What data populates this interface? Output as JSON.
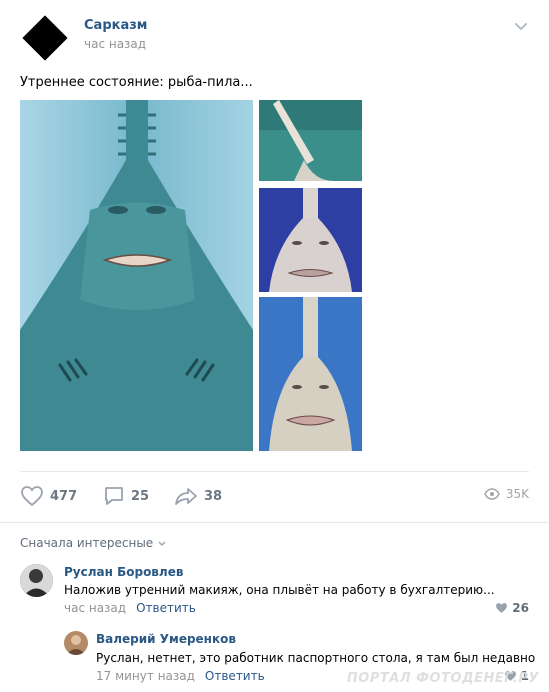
{
  "post": {
    "author": "Сарказм",
    "time": "час назад",
    "text": "Утреннее состояние: рыба-пила..."
  },
  "actions": {
    "likes": "477",
    "comments": "25",
    "shares": "38",
    "views": "35K"
  },
  "sort_label": "Сначала интересные",
  "comments": [
    {
      "author": "Руслан Боровлев",
      "text": "Наложив утренний макияж, она плывёт на работу в бухгалтерию...",
      "time": "час назад",
      "reply": "Ответить",
      "likes": "26"
    },
    {
      "author": "Валерий Умеренков",
      "text": "Руслан, нетнет, это работник паспортного стола, я там был недавно",
      "time": "17 минут назад",
      "reply": "Ответить",
      "likes": "1"
    }
  ],
  "watermark": "ПОРТАЛ ФОТОДЕНЕГ.РУ",
  "colors": {
    "link": "#2a5885",
    "muted": "#939393",
    "divider": "#e7e8ec"
  }
}
